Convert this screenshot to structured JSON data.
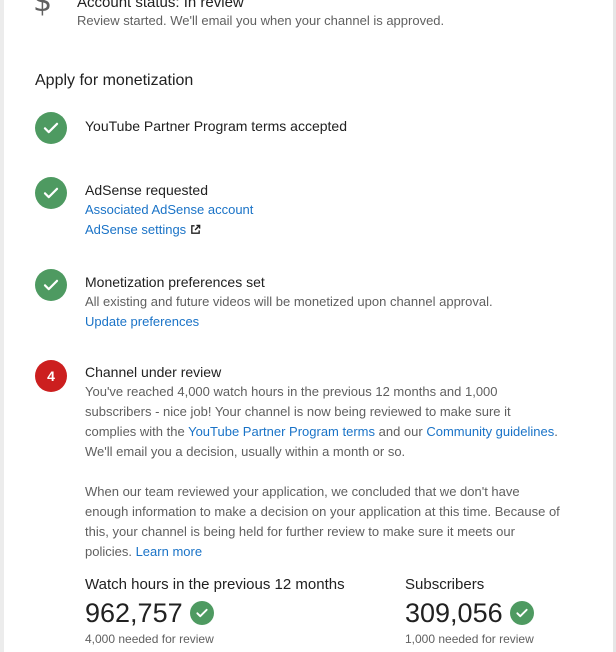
{
  "account_status": {
    "icon": "dollar-icon",
    "title": "Account status: In review",
    "subtitle": "Review started. We'll email you when your channel is approved."
  },
  "section_title": "Apply for monetization",
  "steps": [
    {
      "state": "done",
      "title": "YouTube Partner Program terms accepted"
    },
    {
      "state": "done",
      "title": "AdSense requested",
      "links": [
        "Associated AdSense account",
        "AdSense settings"
      ]
    },
    {
      "state": "done",
      "title": "Monetization preferences set",
      "text": "All existing and future videos will be monetized upon channel approval.",
      "link": "Update preferences"
    },
    {
      "state": "active",
      "number": "4",
      "title": "Channel under review",
      "para1": {
        "before": "You've reached 4,000 watch hours in the previous 12 months and 1,000 subscribers - nice job! Your channel is now being reviewed to make sure it complies with the ",
        "link1": "YouTube Partner Program terms",
        "middle": " and our ",
        "link2": "Community guidelines",
        "after": ". We'll email you a decision, usually within a month or so."
      },
      "para2": {
        "text": "When our team reviewed your application, we concluded that we don't have enough information to make a decision on your application at this time. Because of this, your channel is being held for further review to make sure it meets our policies. ",
        "link": "Learn more"
      }
    }
  ],
  "metrics": {
    "watch_hours": {
      "label": "Watch hours in the previous 12 months",
      "value": "962,757",
      "note": "4,000 needed for review"
    },
    "subscribers": {
      "label": "Subscribers",
      "value": "309,056",
      "note": "1,000 needed for review"
    }
  },
  "colors": {
    "success": "#4e9a61",
    "active_step": "#cc1f1f",
    "link": "#1a73c7"
  }
}
